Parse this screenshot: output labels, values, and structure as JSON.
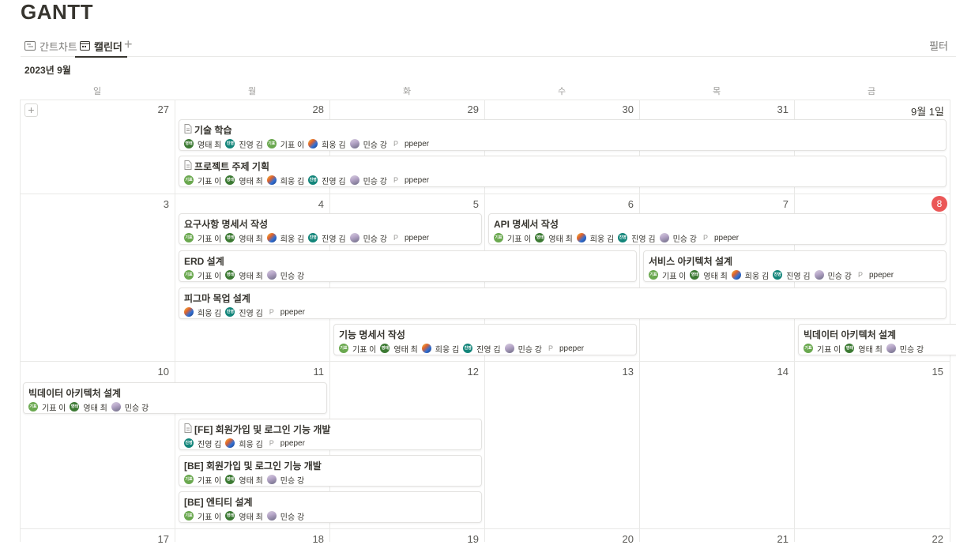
{
  "page": {
    "title": "GANTT"
  },
  "tabs": [
    {
      "label": "간트차트",
      "icon": "timeline-icon"
    },
    {
      "label": "캘린더",
      "icon": "calendar-icon"
    }
  ],
  "toolbar": {
    "add": "+",
    "filter": "필터"
  },
  "calendar": {
    "month_label": "2023년 9월",
    "weekdays": [
      "일",
      "월",
      "화",
      "수",
      "목",
      "금"
    ],
    "weeks": [
      [
        "27",
        "28",
        "29",
        "30",
        "31",
        "9월 1일"
      ],
      [
        "3",
        "4",
        "5",
        "6",
        "7",
        "8"
      ],
      [
        "10",
        "11",
        "12",
        "13",
        "14",
        "15"
      ],
      [
        "17",
        "18",
        "19",
        "20",
        "21",
        "22"
      ]
    ],
    "today": "8"
  },
  "people": {
    "kipyo": {
      "name": "기표 이",
      "tag": "기표",
      "style": "lg"
    },
    "youngtae": {
      "name": "영태 최",
      "tag": "영태",
      "style": "g"
    },
    "hwoong": {
      "name": "희웅 김",
      "tag": "",
      "style": "img"
    },
    "jinyoung": {
      "name": "진영 김",
      "tag": "진영",
      "style": "t"
    },
    "minseung": {
      "name": "민승 강",
      "tag": "",
      "style": "mg"
    },
    "ppeper": {
      "name": "ppeper",
      "tag": "P",
      "style": "pp"
    }
  },
  "events": [
    {
      "title": "기술 학습",
      "doc_icon": true,
      "people": [
        "youngtae",
        "jinyoung",
        "kipyo",
        "hwoong",
        "minseung",
        "ppeper"
      ]
    },
    {
      "title": "프로젝트 주제 기획",
      "doc_icon": true,
      "people": [
        "kipyo",
        "youngtae",
        "hwoong",
        "jinyoung",
        "minseung",
        "ppeper"
      ]
    },
    {
      "title": "요구사항 명세서 작성",
      "doc_icon": false,
      "people": [
        "kipyo",
        "youngtae",
        "hwoong",
        "jinyoung",
        "minseung",
        "ppeper"
      ]
    },
    {
      "title": "API 명세서 작성",
      "doc_icon": false,
      "people": [
        "kipyo",
        "youngtae",
        "hwoong",
        "jinyoung",
        "minseung",
        "ppeper"
      ]
    },
    {
      "title": "ERD 설계",
      "doc_icon": false,
      "people": [
        "kipyo",
        "youngtae",
        "minseung"
      ]
    },
    {
      "title": "서비스 아키텍처 설계",
      "doc_icon": false,
      "people": [
        "kipyo",
        "youngtae",
        "hwoong",
        "jinyoung",
        "minseung",
        "ppeper"
      ]
    },
    {
      "title": "피그마 목업 설계",
      "doc_icon": false,
      "people": [
        "hwoong",
        "jinyoung",
        "ppeper"
      ]
    },
    {
      "title": "기능 명세서 작성",
      "doc_icon": false,
      "people": [
        "kipyo",
        "youngtae",
        "hwoong",
        "jinyoung",
        "minseung",
        "ppeper"
      ]
    },
    {
      "title": "빅데이터 아키텍처 설계",
      "doc_icon": false,
      "people": [
        "kipyo",
        "youngtae",
        "minseung"
      ]
    },
    {
      "title": "빅데이터 아키텍처 설계",
      "doc_icon": false,
      "people": [
        "kipyo",
        "youngtae",
        "minseung"
      ]
    },
    {
      "title": "[FE] 회원가입 및 로그인 기능 개발",
      "doc_icon": true,
      "people": [
        "jinyoung",
        "hwoong",
        "ppeper"
      ]
    },
    {
      "title": "[BE] 회원가입 및 로그인 기능 개발",
      "doc_icon": false,
      "people": [
        "kipyo",
        "youngtae",
        "minseung"
      ]
    },
    {
      "title": "[BE] 엔티티 설계",
      "doc_icon": false,
      "people": [
        "kipyo",
        "youngtae",
        "minseung"
      ]
    }
  ]
}
